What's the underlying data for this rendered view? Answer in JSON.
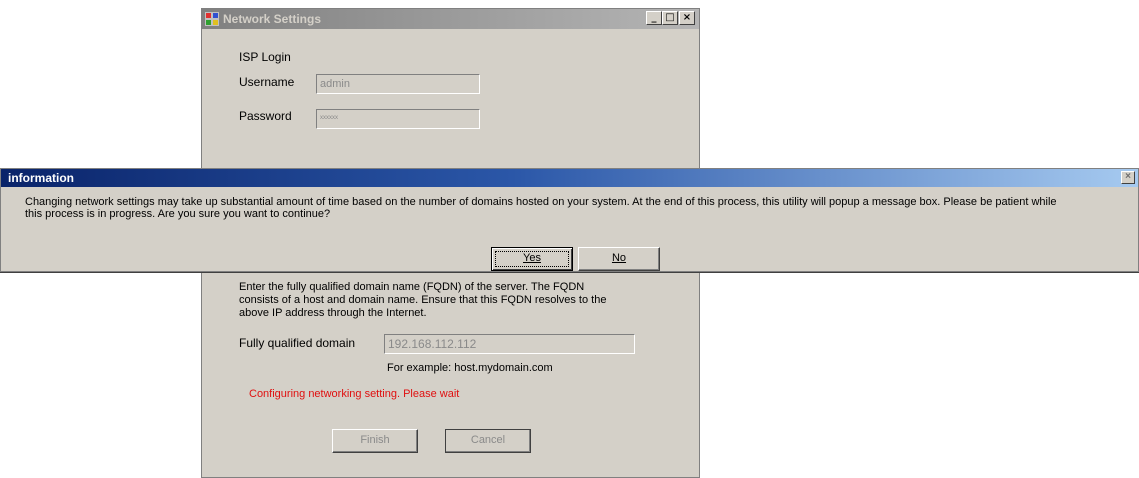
{
  "main_window": {
    "title": "Network Settings",
    "controls": {
      "minimize": "_",
      "maximize": "□",
      "close": "×"
    },
    "isp_login": {
      "heading": "ISP Login",
      "username_label": "Username",
      "username_value": "admin",
      "password_label": "Password",
      "password_value": "xxxxxx"
    },
    "fqdn_description_line1": "Enter the fully qualified domain name (FQDN) of the server. The FQDN",
    "fqdn_description_line2": "consists of a host and domain name. Ensure that this FQDN resolves to the",
    "fqdn_description_line3": "above IP address through the Internet.",
    "fqdn_label": "Fully qualified domain",
    "fqdn_value": "192.168.112.112",
    "example_text": "For example: host.mydomain.com",
    "status_text": "Configuring networking setting. Please wait",
    "finish_label": "Finish",
    "cancel_label": "Cancel"
  },
  "dialog": {
    "title": "information",
    "close": "×",
    "message_line1": "Changing network settings may take up substantial amount of time based on the number of domains hosted on your system. At the end of this process, this utility will popup a message box. Please be patient while",
    "message_line2": "this process is in progress. Are you sure you want to continue?",
    "yes_label": "Yes",
    "no_label": "No"
  },
  "colors": {
    "dialog_title_start": "#0a246a",
    "dialog_title_end": "#a6caf0",
    "status_text": "#e01010",
    "window_bg": "#d4d0c8"
  }
}
